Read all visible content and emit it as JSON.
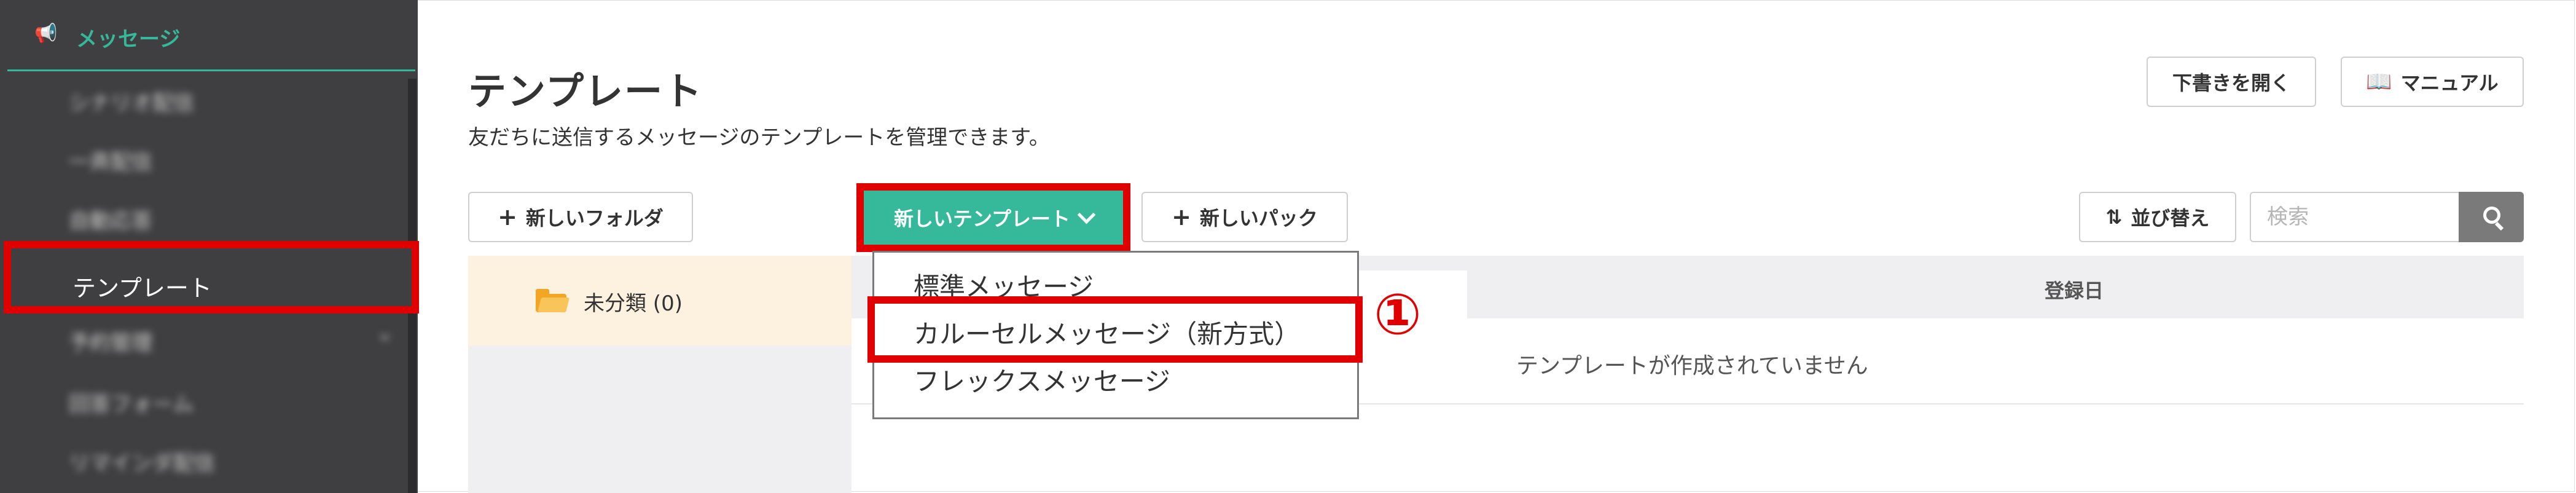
{
  "sidebar": {
    "section_label": "メッセージ",
    "section_icon": "megaphone-icon",
    "items": [
      {
        "label": "シナリオ配信"
      },
      {
        "label": "一斉配信"
      },
      {
        "label": "自動応答"
      },
      {
        "label": "テンプレート"
      },
      {
        "label": "予約管理"
      },
      {
        "label": "回答フォーム"
      },
      {
        "label": "リマインダ配信"
      }
    ],
    "active_label": "テンプレート"
  },
  "header": {
    "title": "テンプレート",
    "subtitle": "友だちに送信するメッセージのテンプレートを管理できます。",
    "draft_button": "下書きを開く",
    "manual_button": "マニュアル"
  },
  "toolbar": {
    "new_folder": "新しいフォルダ",
    "new_template": "新しいテンプレート",
    "new_pack": "新しいパック",
    "sort": "並び替え",
    "search_placeholder": "検索"
  },
  "folders": [
    {
      "label": "未分類 (0)",
      "selected": true
    }
  ],
  "table": {
    "columns": [
      "登録日"
    ],
    "empty_message": "テンプレートが作成されていません"
  },
  "dropdown": {
    "items": [
      {
        "label": "標準メッセージ"
      },
      {
        "label": "カルーセルメッセージ（新方式）"
      },
      {
        "label": "フレックスメッセージ"
      }
    ]
  },
  "annotation": {
    "callout_number": "①"
  },
  "colors": {
    "accent": "#35b99a",
    "sidebar_bg": "#3f3f41",
    "highlight_red": "#e00000",
    "folder_yellow": "#f3a623"
  }
}
